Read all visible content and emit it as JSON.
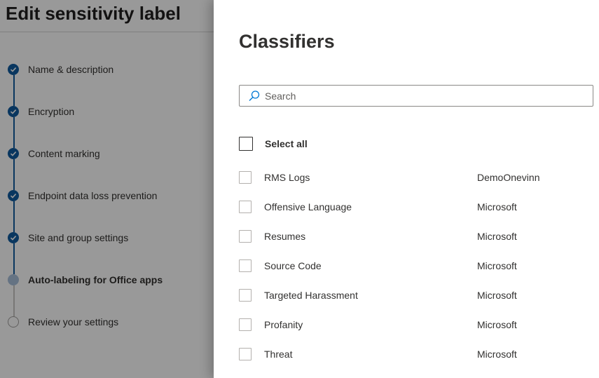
{
  "wizard": {
    "title": "Edit sensitivity label",
    "steps": [
      {
        "label": "Name & description",
        "status": "completed"
      },
      {
        "label": "Encryption",
        "status": "completed"
      },
      {
        "label": "Content marking",
        "status": "completed"
      },
      {
        "label": "Endpoint data loss prevention",
        "status": "completed"
      },
      {
        "label": "Site and group settings",
        "status": "completed"
      },
      {
        "label": "Auto-labeling for Office apps",
        "status": "current"
      },
      {
        "label": "Review your settings",
        "status": "pending"
      }
    ]
  },
  "panel": {
    "title": "Classifiers",
    "search": {
      "placeholder": "Search",
      "value": "",
      "icon": "search-icon"
    },
    "select_all_label": "Select all",
    "classifiers": [
      {
        "name": "RMS Logs",
        "publisher": "DemoOnevinn"
      },
      {
        "name": "Offensive Language",
        "publisher": "Microsoft"
      },
      {
        "name": "Resumes",
        "publisher": "Microsoft"
      },
      {
        "name": "Source Code",
        "publisher": "Microsoft"
      },
      {
        "name": "Targeted Harassment",
        "publisher": "Microsoft"
      },
      {
        "name": "Profanity",
        "publisher": "Microsoft"
      },
      {
        "name": "Threat",
        "publisher": "Microsoft"
      }
    ]
  },
  "colors": {
    "accent": "#0f5a9f",
    "search_icon": "#0078d4",
    "overlay": "rgba(0,0,0,0.4)"
  }
}
